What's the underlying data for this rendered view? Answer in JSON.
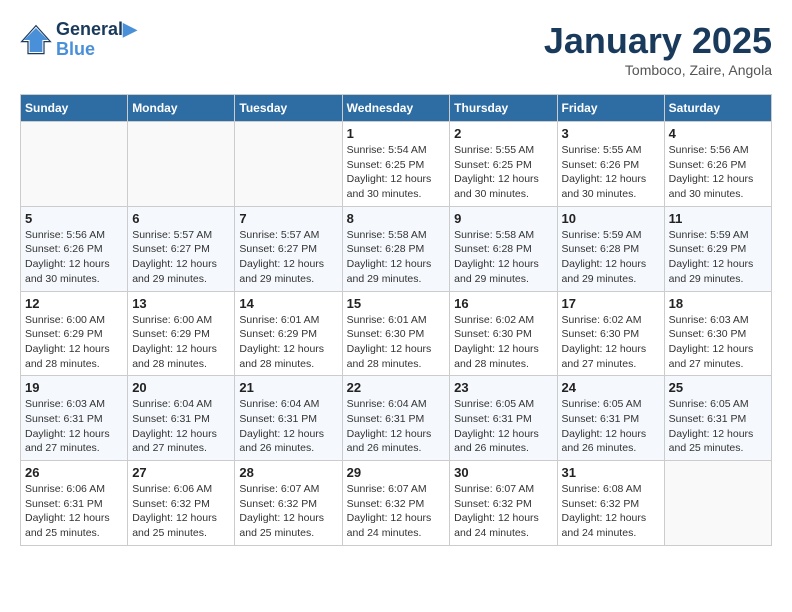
{
  "header": {
    "logo_line1": "General",
    "logo_line2": "Blue",
    "month": "January 2025",
    "location": "Tomboco, Zaire, Angola"
  },
  "days_of_week": [
    "Sunday",
    "Monday",
    "Tuesday",
    "Wednesday",
    "Thursday",
    "Friday",
    "Saturday"
  ],
  "weeks": [
    [
      {
        "day": "",
        "info": ""
      },
      {
        "day": "",
        "info": ""
      },
      {
        "day": "",
        "info": ""
      },
      {
        "day": "1",
        "info": "Sunrise: 5:54 AM\nSunset: 6:25 PM\nDaylight: 12 hours\nand 30 minutes."
      },
      {
        "day": "2",
        "info": "Sunrise: 5:55 AM\nSunset: 6:25 PM\nDaylight: 12 hours\nand 30 minutes."
      },
      {
        "day": "3",
        "info": "Sunrise: 5:55 AM\nSunset: 6:26 PM\nDaylight: 12 hours\nand 30 minutes."
      },
      {
        "day": "4",
        "info": "Sunrise: 5:56 AM\nSunset: 6:26 PM\nDaylight: 12 hours\nand 30 minutes."
      }
    ],
    [
      {
        "day": "5",
        "info": "Sunrise: 5:56 AM\nSunset: 6:26 PM\nDaylight: 12 hours\nand 30 minutes."
      },
      {
        "day": "6",
        "info": "Sunrise: 5:57 AM\nSunset: 6:27 PM\nDaylight: 12 hours\nand 29 minutes."
      },
      {
        "day": "7",
        "info": "Sunrise: 5:57 AM\nSunset: 6:27 PM\nDaylight: 12 hours\nand 29 minutes."
      },
      {
        "day": "8",
        "info": "Sunrise: 5:58 AM\nSunset: 6:28 PM\nDaylight: 12 hours\nand 29 minutes."
      },
      {
        "day": "9",
        "info": "Sunrise: 5:58 AM\nSunset: 6:28 PM\nDaylight: 12 hours\nand 29 minutes."
      },
      {
        "day": "10",
        "info": "Sunrise: 5:59 AM\nSunset: 6:28 PM\nDaylight: 12 hours\nand 29 minutes."
      },
      {
        "day": "11",
        "info": "Sunrise: 5:59 AM\nSunset: 6:29 PM\nDaylight: 12 hours\nand 29 minutes."
      }
    ],
    [
      {
        "day": "12",
        "info": "Sunrise: 6:00 AM\nSunset: 6:29 PM\nDaylight: 12 hours\nand 28 minutes."
      },
      {
        "day": "13",
        "info": "Sunrise: 6:00 AM\nSunset: 6:29 PM\nDaylight: 12 hours\nand 28 minutes."
      },
      {
        "day": "14",
        "info": "Sunrise: 6:01 AM\nSunset: 6:29 PM\nDaylight: 12 hours\nand 28 minutes."
      },
      {
        "day": "15",
        "info": "Sunrise: 6:01 AM\nSunset: 6:30 PM\nDaylight: 12 hours\nand 28 minutes."
      },
      {
        "day": "16",
        "info": "Sunrise: 6:02 AM\nSunset: 6:30 PM\nDaylight: 12 hours\nand 28 minutes."
      },
      {
        "day": "17",
        "info": "Sunrise: 6:02 AM\nSunset: 6:30 PM\nDaylight: 12 hours\nand 27 minutes."
      },
      {
        "day": "18",
        "info": "Sunrise: 6:03 AM\nSunset: 6:30 PM\nDaylight: 12 hours\nand 27 minutes."
      }
    ],
    [
      {
        "day": "19",
        "info": "Sunrise: 6:03 AM\nSunset: 6:31 PM\nDaylight: 12 hours\nand 27 minutes."
      },
      {
        "day": "20",
        "info": "Sunrise: 6:04 AM\nSunset: 6:31 PM\nDaylight: 12 hours\nand 27 minutes."
      },
      {
        "day": "21",
        "info": "Sunrise: 6:04 AM\nSunset: 6:31 PM\nDaylight: 12 hours\nand 26 minutes."
      },
      {
        "day": "22",
        "info": "Sunrise: 6:04 AM\nSunset: 6:31 PM\nDaylight: 12 hours\nand 26 minutes."
      },
      {
        "day": "23",
        "info": "Sunrise: 6:05 AM\nSunset: 6:31 PM\nDaylight: 12 hours\nand 26 minutes."
      },
      {
        "day": "24",
        "info": "Sunrise: 6:05 AM\nSunset: 6:31 PM\nDaylight: 12 hours\nand 26 minutes."
      },
      {
        "day": "25",
        "info": "Sunrise: 6:05 AM\nSunset: 6:31 PM\nDaylight: 12 hours\nand 25 minutes."
      }
    ],
    [
      {
        "day": "26",
        "info": "Sunrise: 6:06 AM\nSunset: 6:31 PM\nDaylight: 12 hours\nand 25 minutes."
      },
      {
        "day": "27",
        "info": "Sunrise: 6:06 AM\nSunset: 6:32 PM\nDaylight: 12 hours\nand 25 minutes."
      },
      {
        "day": "28",
        "info": "Sunrise: 6:07 AM\nSunset: 6:32 PM\nDaylight: 12 hours\nand 25 minutes."
      },
      {
        "day": "29",
        "info": "Sunrise: 6:07 AM\nSunset: 6:32 PM\nDaylight: 12 hours\nand 24 minutes."
      },
      {
        "day": "30",
        "info": "Sunrise: 6:07 AM\nSunset: 6:32 PM\nDaylight: 12 hours\nand 24 minutes."
      },
      {
        "day": "31",
        "info": "Sunrise: 6:08 AM\nSunset: 6:32 PM\nDaylight: 12 hours\nand 24 minutes."
      },
      {
        "day": "",
        "info": ""
      }
    ]
  ]
}
